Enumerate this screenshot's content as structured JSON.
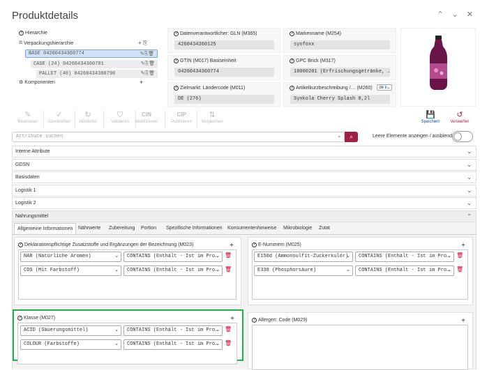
{
  "title": "Produktdetails",
  "header_icons": {
    "up": "⌃",
    "down": "⌄",
    "close": "✕"
  },
  "hierarchy": {
    "label": "Hierarchie",
    "pack_label": "Verpackungshierarchie",
    "rows": [
      {
        "text": "BASE 04260434360774"
      },
      {
        "text": "CASE (24) 04260434360781"
      },
      {
        "text": "PALLET (40) 04260434360798"
      }
    ],
    "components_label": "Komponenten"
  },
  "fields": {
    "datenverantwortlicher": {
      "label": "Datenverantwortlicher: GLN (M365)",
      "value": "4260434360125"
    },
    "gtin": {
      "label": "GTIN (M017) Basiseinheit",
      "value": "04260434360774"
    },
    "zielmarkt": {
      "label": "Zielmarkt: Ländercode (M011)",
      "value": "DE (276)"
    },
    "markenname": {
      "label": "Markenname (M254)",
      "value": "synfoxx"
    },
    "gpc": {
      "label": "GPC Brick (M317)",
      "value": "10000201 (Erfrischungsgetränke, …"
    },
    "artikel": {
      "label": "Artikelkurzbeschreibung /… (M260)",
      "value": "Synkola Cherry Splash 0,2l",
      "lang": "de"
    }
  },
  "toolbar": [
    {
      "label": "Bearbeiten",
      "icon": "✎"
    },
    {
      "label": "Abschließen",
      "icon": "✓"
    },
    {
      "label": "Aktivieren",
      "icon": "↻"
    },
    {
      "label": "Validieren",
      "icon": "⛉"
    },
    {
      "label": "Modifizieren",
      "icon": "CIN"
    },
    {
      "label": "Publizieren",
      "icon": "CIP"
    },
    {
      "label": "Vergleichen",
      "icon": "⇅"
    }
  ],
  "save_label": "Speichern",
  "discard_label": "Verwerfen",
  "search_placeholder": "Attribute suchen",
  "toggle_label": "Leere Elemente anzeigen / ausblenden",
  "accordion": [
    "Interne Attribute",
    "GDSN",
    "Basisdaten",
    "Logistik 1",
    "Logistik 2",
    "Nahrungsmittel"
  ],
  "tabs": [
    "Allgemeine Informationen",
    "Nährwerte",
    "Zubereitung",
    "Portion",
    "Spezifische Informationen",
    "Konsumentenhinweise",
    "Mikrobiologie",
    "Zutat"
  ],
  "sections": {
    "zusatzstoffe": {
      "title": "Deklarationspflichtige Zusatzstoffe und Ergänzungen der Bezeichnung (M023)",
      "rows": [
        {
          "a": "NAR (Natürliche Aromen)",
          "b": "CONTAINS (Enthält - Ist im Pro…"
        },
        {
          "a": "CDS (Mit Farbstoff)",
          "b": "CONTAINS (Enthält - Ist im Pro…"
        }
      ]
    },
    "enummern": {
      "title": "E-Nummern (M025)",
      "rows": [
        {
          "a": "E150d (Ammonsulfit-Zuckerkulör)",
          "b": "CONTAINS (Enthält - Ist im Pro…"
        },
        {
          "a": "E338 (Phosphorsäure)",
          "b": "CONTAINS (Enthält - Ist im Pro…"
        }
      ]
    },
    "klasse": {
      "title": "Klasse (M027)",
      "rows": [
        {
          "a": "ACID (Säuerungsmittel)",
          "b": "CONTAINS (Enthält - Ist im Pro…"
        },
        {
          "a": "COLOUR (Farbstoffe)",
          "b": "CONTAINS (Enthält - Ist im Pro…"
        }
      ]
    },
    "allergen": {
      "title": "Allergen: Code (M029)"
    }
  },
  "colors": {
    "accent": "#a01f44",
    "highlight": "#22b14c",
    "selected": "#cfe2f7"
  }
}
